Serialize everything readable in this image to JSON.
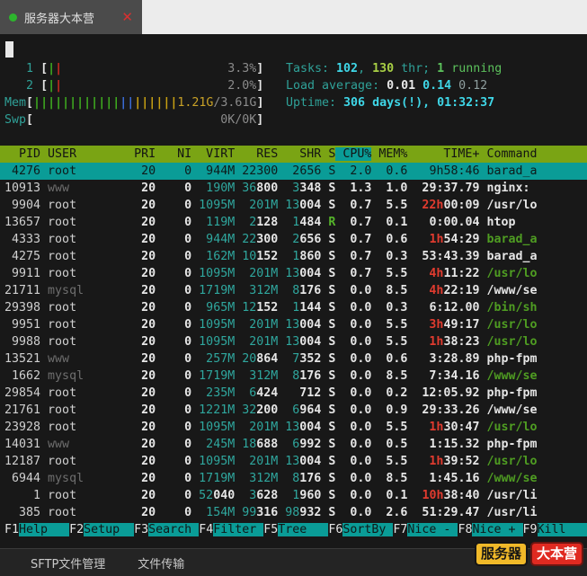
{
  "tab": {
    "title": "服务器大本营",
    "close_glyph": "✕"
  },
  "palette": {
    "header_green_bg": "#7aa414",
    "selection_teal_bg": "#0a9c97",
    "accent_teal_text": "#2fa198",
    "hot_time_red": "#e03b2f",
    "thread_green": "#4f9d22",
    "logo_yellow": "#f0b929",
    "logo_red": "#e02a21",
    "bar_green": "#3fae1f",
    "bar_red": "#cc2a1f",
    "bar_blue": "#3a6bd6",
    "bar_yellow": "#c8a012"
  },
  "meters": {
    "cpus": [
      {
        "id": "1",
        "pct": "3.3%",
        "bars": [
          "green",
          "red"
        ]
      },
      {
        "id": "2",
        "pct": "2.0%",
        "bars": [
          "green",
          "red"
        ]
      }
    ],
    "mem": {
      "label": "Mem",
      "bars": {
        "green": 12,
        "blue": 2,
        "yellow": 6
      },
      "used": "1.21G",
      "total": "/3.61G"
    },
    "swp": {
      "label": "Swp",
      "value": "0K/0K"
    }
  },
  "stats": {
    "tasks": [
      [
        "Tasks: ",
        "teal"
      ],
      [
        "102",
        "cyanB"
      ],
      [
        ", ",
        "teal"
      ],
      [
        "130",
        "limeB"
      ],
      [
        " thr; ",
        "teal"
      ],
      [
        "1",
        "greenB"
      ],
      [
        " running",
        "green"
      ]
    ],
    "load": [
      [
        "Load average: ",
        "teal"
      ],
      [
        "0.01 ",
        "whiteB"
      ],
      [
        "0.14 ",
        "cyanB"
      ],
      [
        "0.12",
        "dimload"
      ]
    ],
    "uptime": [
      [
        "Uptime: ",
        "teal"
      ],
      [
        "306 days(!), 01:32:37",
        "cyanB"
      ]
    ]
  },
  "table": {
    "columns": [
      "PID",
      "USER",
      "PRI",
      "NI",
      "VIRT",
      "RES",
      "SHR",
      "S",
      "CPU%",
      "MEM%",
      "TIME+",
      "Command"
    ],
    "sort_column": "CPU%",
    "rows": [
      {
        "pid": "4276",
        "user": "root",
        "pri": "20",
        "ni": "0",
        "virt": "944M",
        "res": "22300",
        "shr": "2656",
        "s": "S",
        "cpu": "2.0",
        "mem": "0.6",
        "time": "9h58:46",
        "cmd": "barad_a",
        "flags": "sel"
      },
      {
        "pid": "10913",
        "user": "www",
        "pri": "20",
        "ni": "0",
        "virt": "190M",
        "res": "36800",
        "shr": "3348",
        "s": "S",
        "cpu": "1.3",
        "mem": "1.0",
        "time": "29:37.79",
        "cmd": "nginx:",
        "flags": "d"
      },
      {
        "pid": "9904",
        "user": "root",
        "pri": "20",
        "ni": "0",
        "virt": "1095M",
        "res": "201M",
        "shr": "13004",
        "s": "S",
        "cpu": "0.7",
        "mem": "5.5",
        "time": "22h00:09",
        "cmd": "/usr/lo",
        "flags": ""
      },
      {
        "pid": "13657",
        "user": "root",
        "pri": "20",
        "ni": "0",
        "virt": "119M",
        "res": "2128",
        "shr": "1484",
        "s": "R",
        "cpu": "0.7",
        "mem": "0.1",
        "time": "0:00.04",
        "cmd": "htop",
        "flags": ""
      },
      {
        "pid": "4333",
        "user": "root",
        "pri": "20",
        "ni": "0",
        "virt": "944M",
        "res": "22300",
        "shr": "2656",
        "s": "S",
        "cpu": "0.7",
        "mem": "0.6",
        "time": "1h54:29",
        "cmd": "barad_a",
        "flags": "g"
      },
      {
        "pid": "4275",
        "user": "root",
        "pri": "20",
        "ni": "0",
        "virt": "162M",
        "res": "10152",
        "shr": "1860",
        "s": "S",
        "cpu": "0.7",
        "mem": "0.3",
        "time": "53:43.39",
        "cmd": "barad_a",
        "flags": ""
      },
      {
        "pid": "9911",
        "user": "root",
        "pri": "20",
        "ni": "0",
        "virt": "1095M",
        "res": "201M",
        "shr": "13004",
        "s": "S",
        "cpu": "0.7",
        "mem": "5.5",
        "time": "4h11:22",
        "cmd": "/usr/lo",
        "flags": "g"
      },
      {
        "pid": "21711",
        "user": "mysql",
        "pri": "20",
        "ni": "0",
        "virt": "1719M",
        "res": "312M",
        "shr": "8176",
        "s": "S",
        "cpu": "0.0",
        "mem": "8.5",
        "time": "4h22:19",
        "cmd": "/www/se",
        "flags": "d"
      },
      {
        "pid": "29398",
        "user": "root",
        "pri": "20",
        "ni": "0",
        "virt": "965M",
        "res": "12152",
        "shr": "1144",
        "s": "S",
        "cpu": "0.0",
        "mem": "0.3",
        "time": "6:12.00",
        "cmd": "/bin/sh",
        "flags": "g"
      },
      {
        "pid": "9951",
        "user": "root",
        "pri": "20",
        "ni": "0",
        "virt": "1095M",
        "res": "201M",
        "shr": "13004",
        "s": "S",
        "cpu": "0.0",
        "mem": "5.5",
        "time": "3h49:17",
        "cmd": "/usr/lo",
        "flags": "g"
      },
      {
        "pid": "9988",
        "user": "root",
        "pri": "20",
        "ni": "0",
        "virt": "1095M",
        "res": "201M",
        "shr": "13004",
        "s": "S",
        "cpu": "0.0",
        "mem": "5.5",
        "time": "1h38:23",
        "cmd": "/usr/lo",
        "flags": "g"
      },
      {
        "pid": "13521",
        "user": "www",
        "pri": "20",
        "ni": "0",
        "virt": "257M",
        "res": "20864",
        "shr": "7352",
        "s": "S",
        "cpu": "0.0",
        "mem": "0.6",
        "time": "3:28.89",
        "cmd": "php-fpm",
        "flags": "d"
      },
      {
        "pid": "1662",
        "user": "mysql",
        "pri": "20",
        "ni": "0",
        "virt": "1719M",
        "res": "312M",
        "shr": "8176",
        "s": "S",
        "cpu": "0.0",
        "mem": "8.5",
        "time": "7:34.16",
        "cmd": "/www/se",
        "flags": "dg"
      },
      {
        "pid": "29854",
        "user": "root",
        "pri": "20",
        "ni": "0",
        "virt": "235M",
        "res": "6424",
        "shr": "712",
        "s": "S",
        "cpu": "0.0",
        "mem": "0.2",
        "time": "12:05.92",
        "cmd": "php-fpm",
        "flags": ""
      },
      {
        "pid": "21761",
        "user": "root",
        "pri": "20",
        "ni": "0",
        "virt": "1221M",
        "res": "32200",
        "shr": "6964",
        "s": "S",
        "cpu": "0.0",
        "mem": "0.9",
        "time": "29:33.26",
        "cmd": "/www/se",
        "flags": ""
      },
      {
        "pid": "23928",
        "user": "root",
        "pri": "20",
        "ni": "0",
        "virt": "1095M",
        "res": "201M",
        "shr": "13004",
        "s": "S",
        "cpu": "0.0",
        "mem": "5.5",
        "time": "1h30:47",
        "cmd": "/usr/lo",
        "flags": "g"
      },
      {
        "pid": "14031",
        "user": "www",
        "pri": "20",
        "ni": "0",
        "virt": "245M",
        "res": "18688",
        "shr": "6992",
        "s": "S",
        "cpu": "0.0",
        "mem": "0.5",
        "time": "1:15.32",
        "cmd": "php-fpm",
        "flags": "d"
      },
      {
        "pid": "12187",
        "user": "root",
        "pri": "20",
        "ni": "0",
        "virt": "1095M",
        "res": "201M",
        "shr": "13004",
        "s": "S",
        "cpu": "0.0",
        "mem": "5.5",
        "time": "1h39:52",
        "cmd": "/usr/lo",
        "flags": "g"
      },
      {
        "pid": "6944",
        "user": "mysql",
        "pri": "20",
        "ni": "0",
        "virt": "1719M",
        "res": "312M",
        "shr": "8176",
        "s": "S",
        "cpu": "0.0",
        "mem": "8.5",
        "time": "1:45.16",
        "cmd": "/www/se",
        "flags": "dg"
      },
      {
        "pid": "1",
        "user": "root",
        "pri": "20",
        "ni": "0",
        "virt": "52040",
        "res": "3628",
        "shr": "1960",
        "s": "S",
        "cpu": "0.0",
        "mem": "0.1",
        "time": "10h38:40",
        "cmd": "/usr/li",
        "flags": ""
      },
      {
        "pid": "385",
        "user": "root",
        "pri": "20",
        "ni": "0",
        "virt": "154M",
        "res": "99316",
        "shr": "98932",
        "s": "S",
        "cpu": "0.0",
        "mem": "2.6",
        "time": "51:29.47",
        "cmd": "/usr/li",
        "flags": ""
      }
    ]
  },
  "fnbar": [
    {
      "key": "F1",
      "label": "Help"
    },
    {
      "key": "F2",
      "label": "Setup"
    },
    {
      "key": "F3",
      "label": "Search"
    },
    {
      "key": "F4",
      "label": "Filter"
    },
    {
      "key": "F5",
      "label": "Tree"
    },
    {
      "key": "F6",
      "label": "SortBy"
    },
    {
      "key": "F7",
      "label": "Nice -"
    },
    {
      "key": "F8",
      "label": "Nice +"
    },
    {
      "key": "F9",
      "label": "Kill"
    }
  ],
  "bottom": {
    "items": [
      "SFTP文件管理",
      "文件传输"
    ],
    "logo": [
      "服务器",
      "大本营"
    ]
  }
}
